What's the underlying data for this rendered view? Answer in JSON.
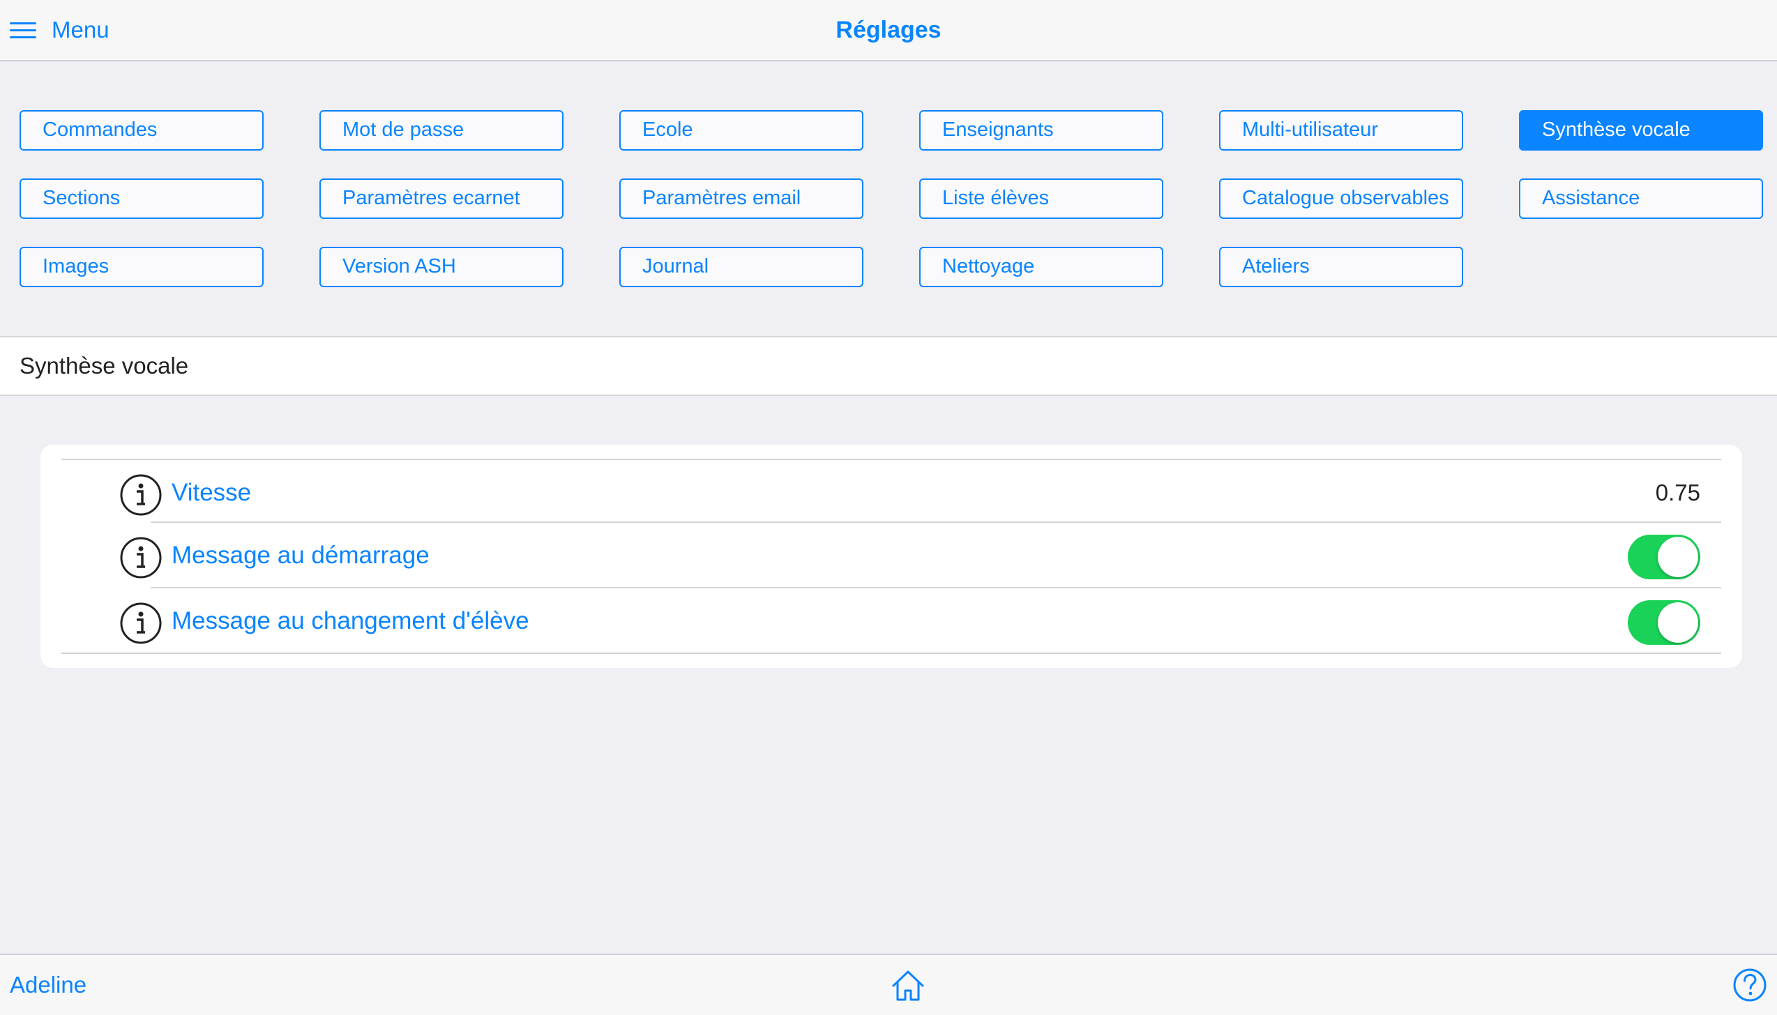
{
  "header": {
    "menu_label": "Menu",
    "title": "Réglages",
    "menu_icon": "hamburger-icon"
  },
  "categories": [
    {
      "label": "Commandes",
      "active": false
    },
    {
      "label": "Mot de passe",
      "active": false
    },
    {
      "label": "Ecole",
      "active": false
    },
    {
      "label": "Enseignants",
      "active": false
    },
    {
      "label": "Multi-utilisateur",
      "active": false
    },
    {
      "label": "Synthèse vocale",
      "active": true
    },
    {
      "label": "Sections",
      "active": false
    },
    {
      "label": "Paramètres ecarnet",
      "active": false
    },
    {
      "label": "Paramètres email",
      "active": false
    },
    {
      "label": "Liste élèves",
      "active": false
    },
    {
      "label": "Catalogue observables",
      "active": false
    },
    {
      "label": "Assistance",
      "active": false
    },
    {
      "label": "Images",
      "active": false
    },
    {
      "label": "Version ASH",
      "active": false
    },
    {
      "label": "Journal",
      "active": false
    },
    {
      "label": "Nettoyage",
      "active": false
    },
    {
      "label": "Ateliers",
      "active": false
    }
  ],
  "section": {
    "title": "Synthèse vocale"
  },
  "settings": [
    {
      "label": "Vitesse",
      "value": "0.75",
      "type": "value",
      "icon": "info-icon"
    },
    {
      "label": "Message au démarrage",
      "type": "toggle",
      "on": true,
      "icon": "info-icon"
    },
    {
      "label": "Message au changement d'élève",
      "type": "toggle",
      "on": true,
      "icon": "info-icon"
    }
  ],
  "footer": {
    "user_name": "Adeline",
    "home_icon": "home-icon",
    "help_icon": "help-icon"
  },
  "colors": {
    "accent": "#0a84ff",
    "toggle_on": "#19d257",
    "background": "#efeff4"
  }
}
